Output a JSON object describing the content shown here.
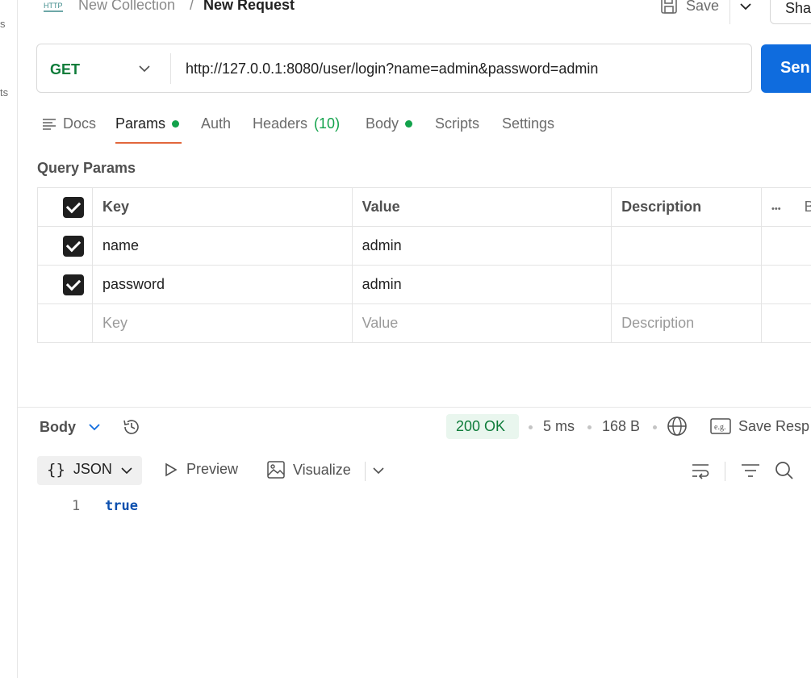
{
  "left_rail": {
    "fragment_1": "s",
    "fragment_2": "ts"
  },
  "breadcrumb": {
    "icon": "http-icon",
    "parent": "New Collection",
    "separator": "/",
    "current": "New Request"
  },
  "header_actions": {
    "save_label": "Save",
    "share_label": "Sha"
  },
  "request": {
    "method": "GET",
    "url": "http://127.0.0.1:8080/user/login?name=admin&password=admin",
    "send_label": "Sen"
  },
  "tabs": {
    "docs": "Docs",
    "params": "Params",
    "auth": "Auth",
    "headers": "Headers",
    "headers_count": "(10)",
    "body": "Body",
    "scripts": "Scripts",
    "settings": "Settings"
  },
  "query_params": {
    "title": "Query Params",
    "headers": {
      "key": "Key",
      "value": "Value",
      "description": "Description",
      "more": "•••",
      "bulk": "B"
    },
    "rows": [
      {
        "key": "name",
        "value": "admin",
        "checked": true
      },
      {
        "key": "password",
        "value": "admin",
        "checked": true
      }
    ],
    "placeholder": {
      "key": "Key",
      "value": "Value",
      "description": "Description"
    }
  },
  "response": {
    "label": "Body",
    "status": "200 OK",
    "time": "5 ms",
    "size": "168 B",
    "save_label": "Save Resp",
    "format": "JSON",
    "preview": "Preview",
    "visualize": "Visualize",
    "line_number": "1",
    "content": "true"
  },
  "colors": {
    "send": "#0f6cde",
    "method": "#0e7c3a",
    "active_tab": "#e2673c",
    "status_bg": "#e9f6ee",
    "dot": "#12a24b"
  }
}
